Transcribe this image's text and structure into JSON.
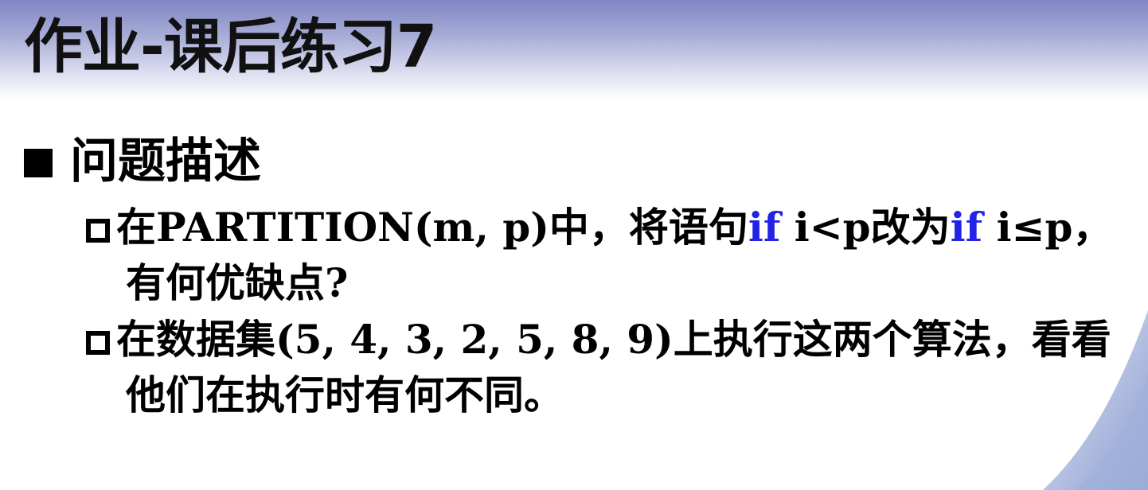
{
  "slide": {
    "title": "作业-课后练习7",
    "heading": "问题描述",
    "items": [
      {
        "line1": {
          "t1": "在PARTITION(m, p)中，将语句",
          "k1": "if",
          "t2": " i<p改为",
          "k2": "if",
          "t3": "  i≤p，"
        },
        "line2": "有何优缺点?"
      },
      {
        "line1": "在数据集(5, 4, 3, 2, 5, 8, 9)上执行这两个算法，看看",
        "line2": "他们在执行时有何不同。"
      }
    ]
  },
  "theme": {
    "header_gradient_top": "#7f86c2",
    "keyword_color": "#2323e6",
    "swoosh_color": "#a9b6dc"
  }
}
